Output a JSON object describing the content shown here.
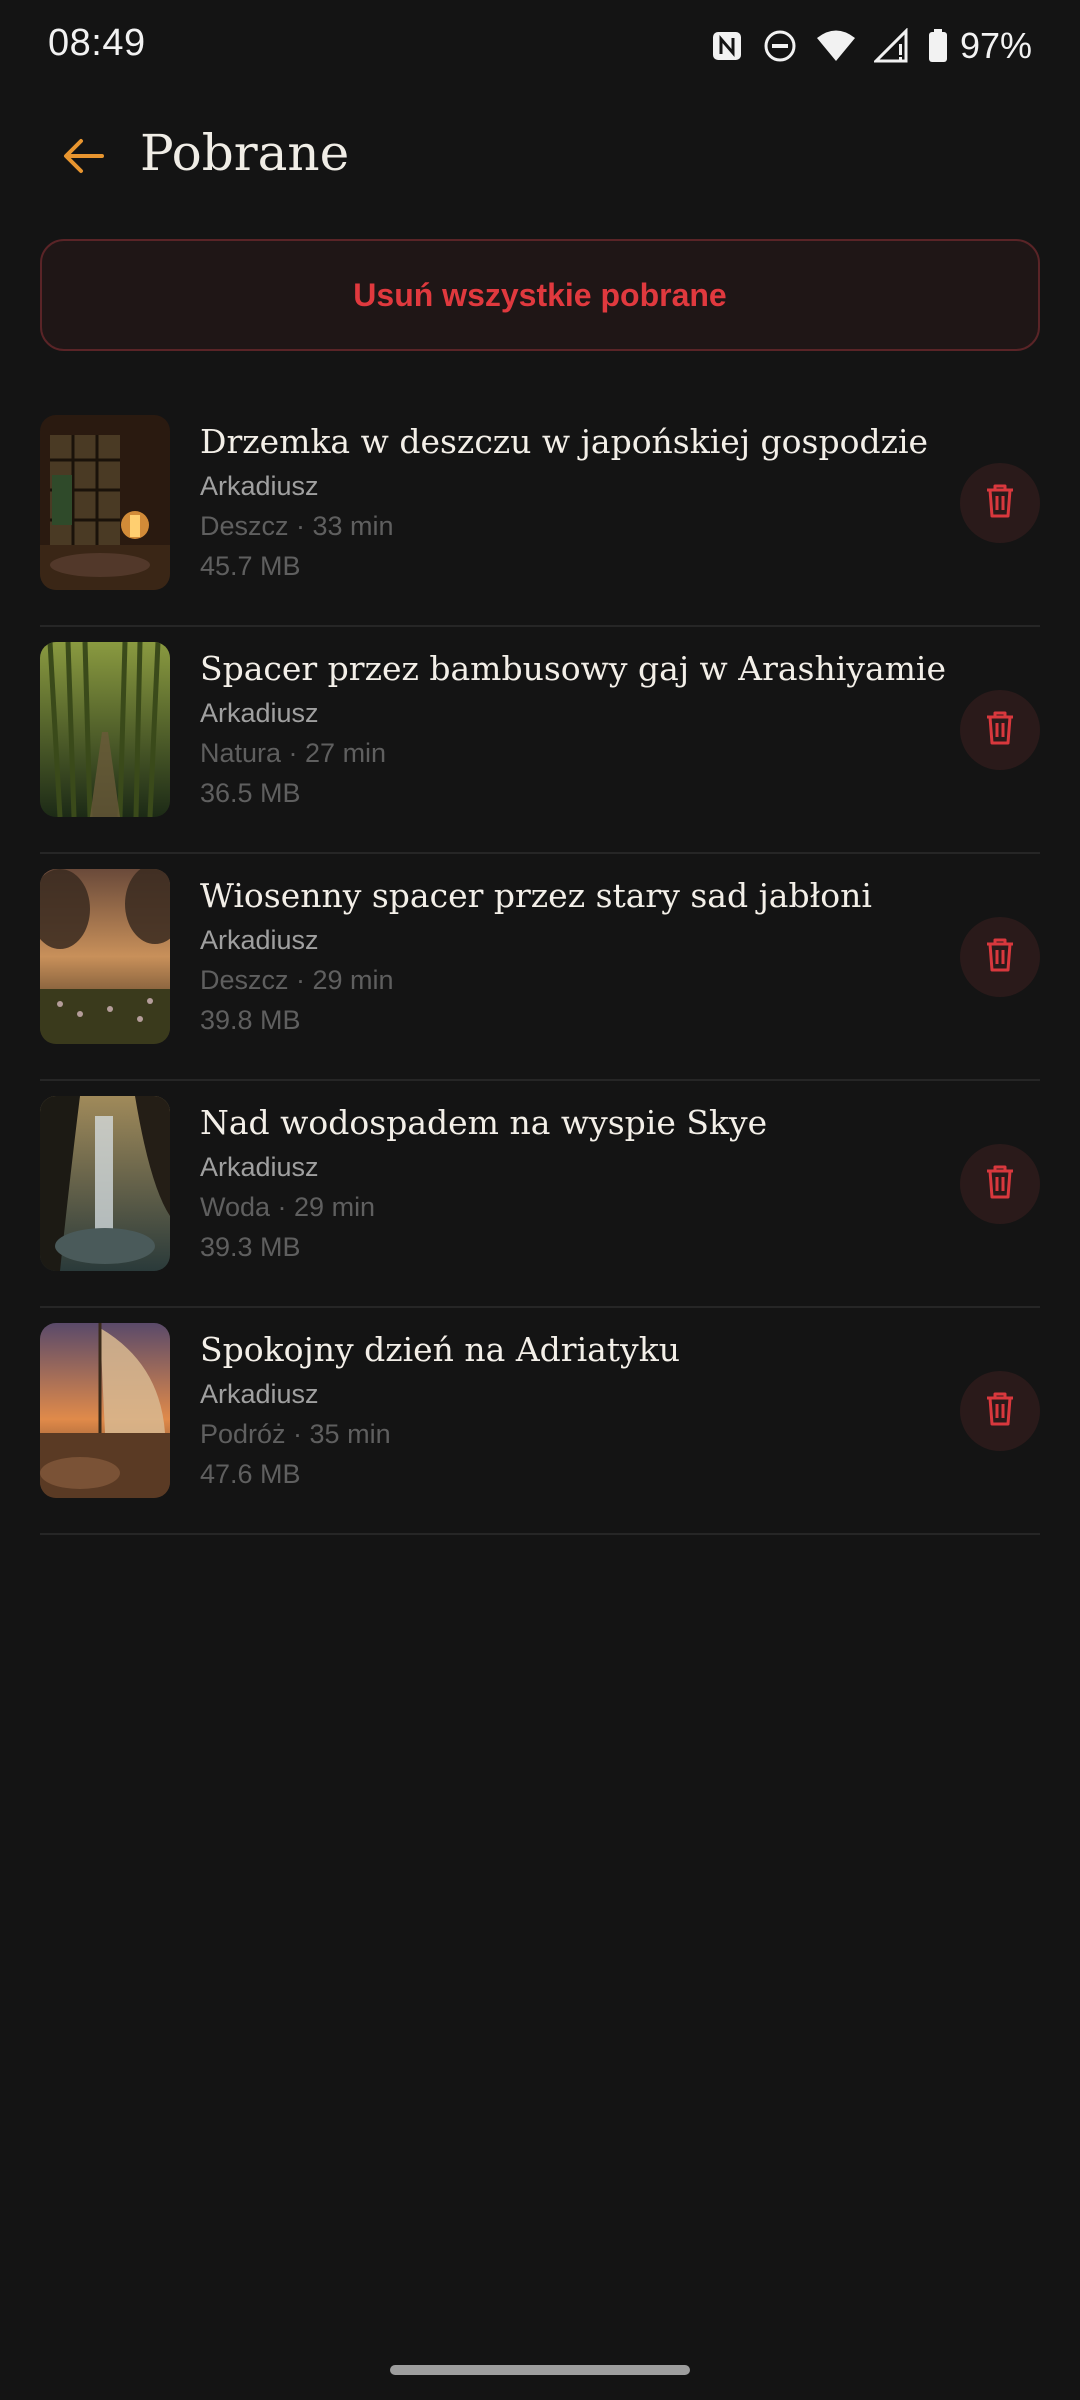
{
  "status_bar": {
    "time": "08:49",
    "battery": "97%",
    "icons": [
      "nfc-icon",
      "do-not-disturb-icon",
      "wifi-icon",
      "signal-icon",
      "battery-icon"
    ]
  },
  "header": {
    "title": "Pobrane",
    "back_icon": "arrow-left-icon"
  },
  "delete_all_label": "Usuń wszystkie pobrane",
  "colors": {
    "background": "#141414",
    "accent_back": "#e8952f",
    "danger": "#e0393e"
  },
  "downloads": [
    {
      "title": "Drzemka w deszczu w japońskiej gospodzie",
      "author": "Arkadiusz",
      "meta": "Deszcz · 33 min",
      "size": "45.7 MB"
    },
    {
      "title": "Spacer przez bambusowy gaj w Arashiyamie",
      "author": "Arkadiusz",
      "meta": "Natura · 27 min",
      "size": "36.5 MB"
    },
    {
      "title": "Wiosenny spacer przez stary sad jabłoni",
      "author": "Arkadiusz",
      "meta": "Deszcz · 29 min",
      "size": "39.8 MB"
    },
    {
      "title": "Nad wodospadem na wyspie Skye",
      "author": "Arkadiusz",
      "meta": "Woda · 29 min",
      "size": "39.3 MB"
    },
    {
      "title": "Spokojny dzień na Adriatyku",
      "author": "Arkadiusz",
      "meta": "Podróż · 35 min",
      "size": "47.6 MB"
    }
  ]
}
